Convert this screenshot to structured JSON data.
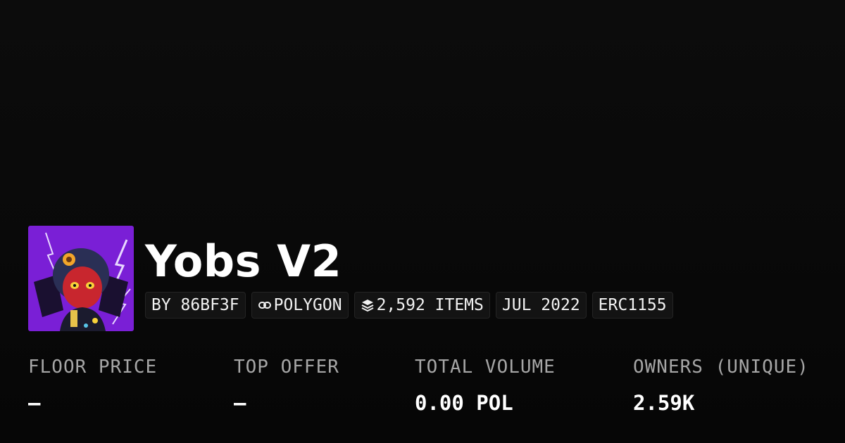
{
  "collection": {
    "name": "Yobs V2",
    "avatar_alt": "avatar-character-art"
  },
  "badges": {
    "creator": "BY 86BF3F",
    "chain": "POLYGON",
    "chain_icon": "link-icon",
    "items": "2,592 ITEMS",
    "items_icon": "layers-icon",
    "date": "JUL 2022",
    "standard": "ERC1155"
  },
  "stats": [
    {
      "label": "FLOOR PRICE",
      "value": "–"
    },
    {
      "label": "TOP OFFER",
      "value": "–"
    },
    {
      "label": "TOTAL VOLUME",
      "value": "0.00 POL"
    },
    {
      "label": "OWNERS (UNIQUE)",
      "value": "2.59K"
    }
  ],
  "colors": {
    "background": "#0a0a0a",
    "badge_bg": "#131313",
    "badge_border": "#242424",
    "label": "#a6a6a6",
    "value": "#ffffff",
    "avatar_bg": "#7a1fd6"
  }
}
